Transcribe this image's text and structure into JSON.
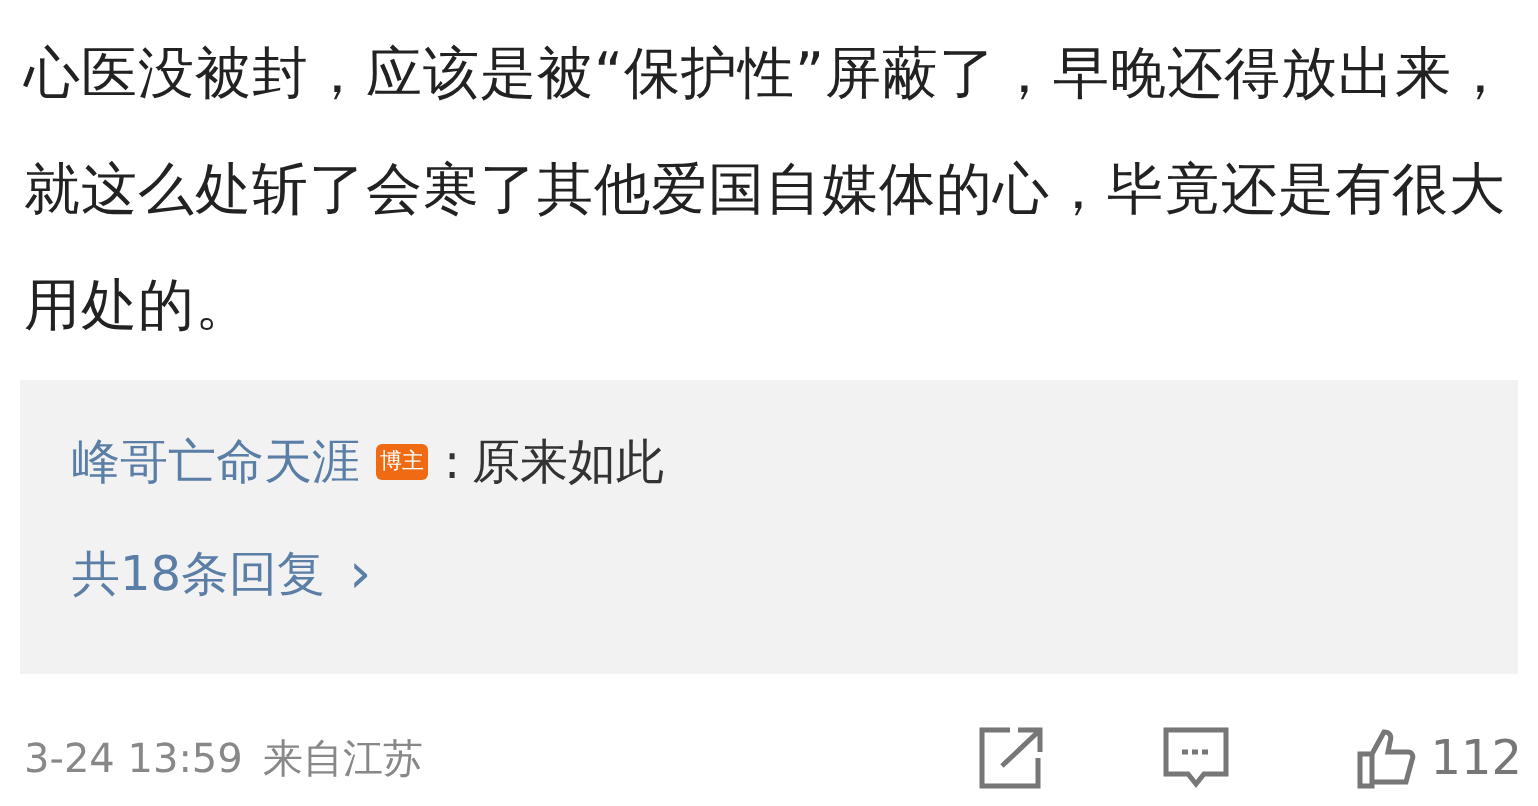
{
  "comment": {
    "text": "心医没被封，应该是被“保护性”屏蔽了，早晚还得放出来，就这么处斩了会寒了其他爱国自媒体的心，毕竟还是有很大用处的。"
  },
  "reply_preview": {
    "author": "峰哥亡命天涯",
    "badge": "博主",
    "separator": ":",
    "text": "原来如此",
    "more": "共18条回复",
    "chevron": "›"
  },
  "footer": {
    "time": "3-24 13:59",
    "location": "来自江苏",
    "like_count": "112"
  }
}
